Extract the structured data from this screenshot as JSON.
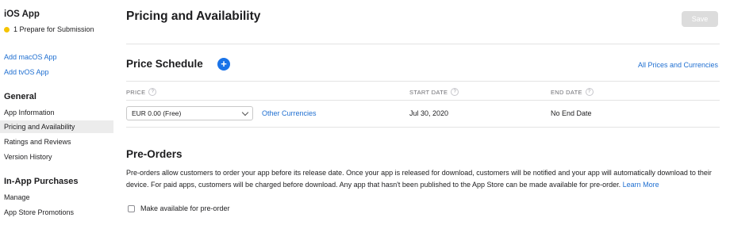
{
  "sidebar": {
    "app_title": "iOS App",
    "status": "1 Prepare for Submission",
    "status_color": "#f5c400",
    "add_links": [
      "Add macOS App",
      "Add tvOS App"
    ],
    "general_heading": "General",
    "general_items": [
      "App Information",
      "Pricing and Availability",
      "Ratings and Reviews",
      "Version History"
    ],
    "active_item": "Pricing and Availability",
    "iap_heading": "In-App Purchases",
    "iap_items": [
      "Manage",
      "App Store Promotions"
    ]
  },
  "header": {
    "title": "Pricing and Availability",
    "save_label": "Save"
  },
  "price_schedule": {
    "title": "Price Schedule",
    "add_icon": "plus-circle-icon",
    "all_prices_link": "All Prices and Currencies",
    "columns": [
      "PRICE",
      "START DATE",
      "END DATE"
    ],
    "row": {
      "price_select": "EUR 0.00 (Free)",
      "other_currencies": "Other Currencies",
      "start_date": "Jul 30, 2020",
      "end_date": "No End Date"
    }
  },
  "preorders": {
    "title": "Pre-Orders",
    "description": "Pre-orders allow customers to order your app before its release date. Once your app is released for download, customers will be notified and your app will automatically download to their device. For paid apps, customers will be charged before download. Any app that hasn't been published to the App Store can be made available for pre-order.",
    "learn_more": "Learn More",
    "checkbox_label": "Make available for pre-order",
    "checkbox_checked": false
  },
  "colors": {
    "accent": "#1a73e8",
    "link": "#1f6fd1"
  }
}
